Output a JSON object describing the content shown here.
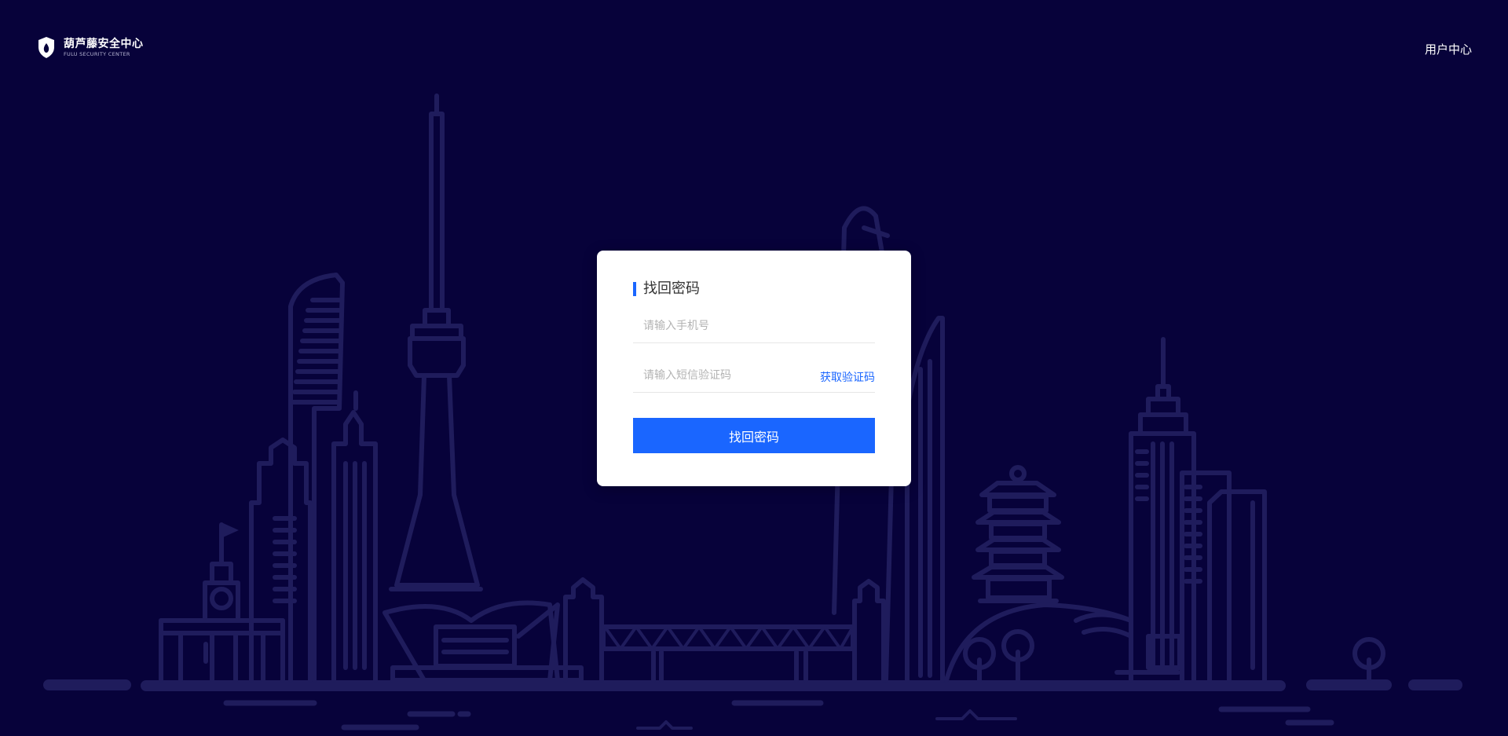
{
  "header": {
    "logo_title": "葫芦藤安全中心",
    "logo_subtitle": "FULU SECURITY CENTER",
    "user_center": "用户中心"
  },
  "form": {
    "title": "找回密码",
    "phone_placeholder": "请输入手机号",
    "code_placeholder": "请输入短信验证码",
    "get_code_label": "获取验证码",
    "submit_label": "找回密码"
  },
  "colors": {
    "background": "#07023a",
    "accent": "#1a66ff",
    "illustration": "#1f1c5c"
  },
  "icons": [
    "shield-logo-icon"
  ]
}
